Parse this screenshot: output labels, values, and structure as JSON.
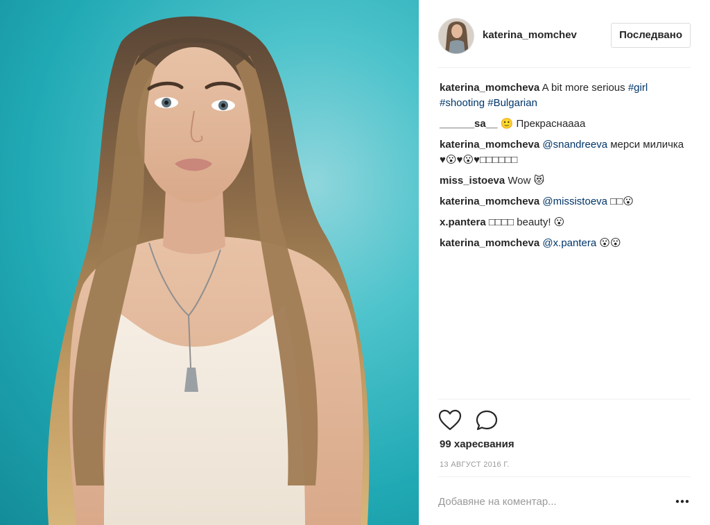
{
  "post": {
    "author": "katerina_momchev",
    "follow_label": "Последвано",
    "likes": "99 харесвания",
    "date": "13 АВГУСТ 2016 Г.",
    "add_comment_placeholder": "Добавяне на коментар..."
  },
  "comments": [
    {
      "user": "katerina_momcheva",
      "parts": [
        {
          "t": "A bit more serious "
        },
        {
          "t": "#girl",
          "link": true
        },
        {
          "t": " "
        },
        {
          "t": "#shooting",
          "link": true
        },
        {
          "t": " "
        },
        {
          "t": "#Bulgarian",
          "link": true
        }
      ]
    },
    {
      "user": "______sa__",
      "parts": [
        {
          "t": "🙂 Прекраснаааа"
        }
      ]
    },
    {
      "user": "katerina_momcheva",
      "parts": [
        {
          "t": "@snandreeva",
          "link": true
        },
        {
          "t": " мерси миличка ♥😮♥😮♥□□□□□□"
        }
      ]
    },
    {
      "user": "miss_istoeva",
      "parts": [
        {
          "t": "Wow 😻"
        }
      ]
    },
    {
      "user": "katerina_momcheva",
      "parts": [
        {
          "t": "@missistoeva",
          "link": true
        },
        {
          "t": " □□😮"
        }
      ]
    },
    {
      "user": "x.pantera",
      "parts": [
        {
          "t": "□□□□ beauty! 😮"
        }
      ]
    },
    {
      "user": "katerina_momcheva",
      "parts": [
        {
          "t": "@x.pantera",
          "link": true
        },
        {
          "t": " 😮😮"
        }
      ]
    }
  ],
  "icons": {
    "like": "heart-icon",
    "comment": "comment-bubble-icon",
    "more": "more-options-icon"
  },
  "colors": {
    "link": "#003569",
    "photo_background": "#1faab5",
    "meta": "#999999"
  }
}
